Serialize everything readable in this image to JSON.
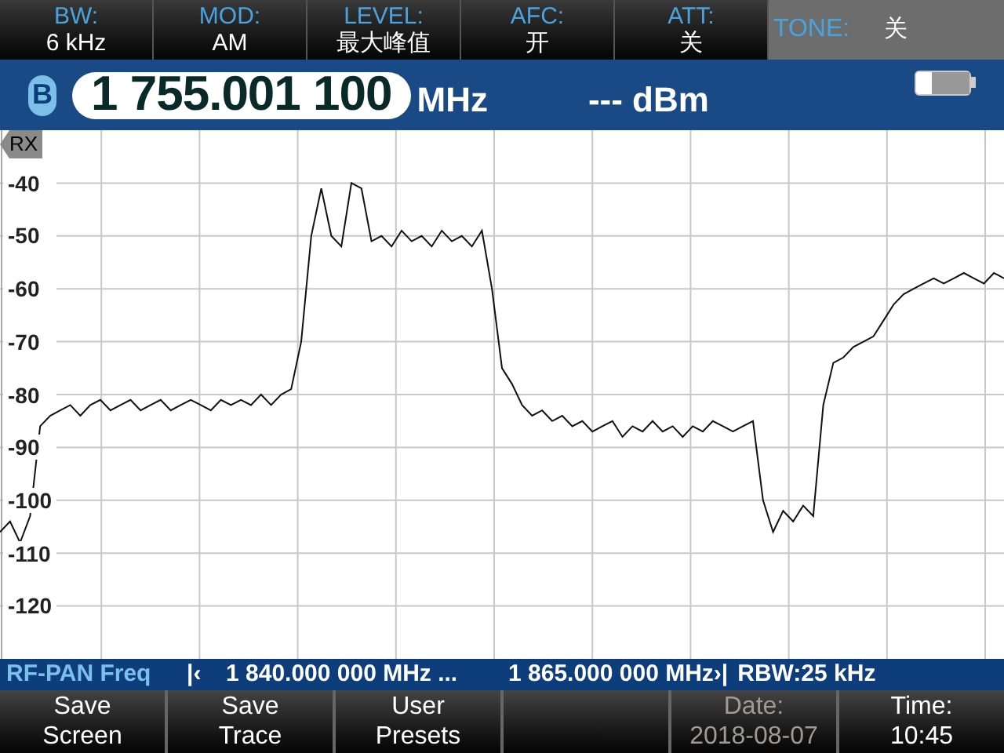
{
  "settings": [
    {
      "label": "BW:",
      "value": "6 kHz"
    },
    {
      "label": "MOD:",
      "value": "AM"
    },
    {
      "label": "LEVEL:",
      "value": "最大峰值"
    },
    {
      "label": "AFC:",
      "value": "开"
    },
    {
      "label": "ATT:",
      "value": "关"
    }
  ],
  "tone": {
    "label": "TONE:",
    "value": "关"
  },
  "receiver": {
    "badge": "B",
    "frequency": "1 755.001 100",
    "unit": "MHz",
    "level": "--- dBm"
  },
  "spectrum": {
    "chart_data": {
      "type": "line",
      "ylim": [
        -130,
        -30
      ],
      "grid": true,
      "yticks": [
        -40,
        -50,
        -60,
        -70,
        -80,
        -90,
        -100,
        -110,
        -120
      ],
      "categories": [
        null,
        null,
        null,
        null,
        null,
        null,
        null,
        null,
        null,
        null,
        null,
        null,
        null,
        null,
        null,
        null,
        null,
        null,
        null,
        null,
        null,
        null,
        null,
        null,
        null,
        null,
        null,
        null,
        null,
        null,
        null,
        null,
        null,
        null,
        null,
        null,
        null,
        null,
        null,
        null,
        null,
        null,
        null,
        null,
        null,
        null,
        null,
        null,
        null,
        null,
        null,
        null,
        null,
        null,
        null,
        null,
        null,
        null,
        null,
        null,
        null,
        null,
        null,
        null,
        null,
        null,
        null,
        null,
        null,
        null,
        null,
        null,
        null,
        null,
        null,
        null,
        null,
        null,
        null,
        null,
        null,
        null,
        null,
        null,
        null,
        null,
        null,
        null,
        null,
        null,
        null,
        null,
        null,
        null,
        null,
        null,
        null,
        null,
        null,
        null,
        null
      ],
      "series": [
        {
          "name": "RX",
          "color": "#111111",
          "values": [
            -106,
            -104,
            -108,
            -103,
            -86,
            -84,
            -83,
            -82,
            -84,
            -82,
            -81,
            -83,
            -82,
            -81,
            -83,
            -82,
            -81,
            -83,
            -82,
            -81,
            -82,
            -83,
            -81,
            -82,
            -81,
            -82,
            -80,
            -82,
            -80,
            -79,
            -70,
            -50,
            -41,
            -50,
            -52,
            -40,
            -41,
            -51,
            -50,
            -52,
            -49,
            -51,
            -50,
            -52,
            -49,
            -51,
            -50,
            -52,
            -49,
            -60,
            -75,
            -78,
            -82,
            -84,
            -83,
            -85,
            -84,
            -86,
            -85,
            -87,
            -86,
            -85,
            -88,
            -86,
            -87,
            -85,
            -87,
            -86,
            -88,
            -86,
            -87,
            -85,
            -86,
            -87,
            -86,
            -85,
            -100,
            -106,
            -102,
            -104,
            -101,
            -103,
            -82,
            -74,
            -73,
            -71,
            -70,
            -69,
            -66,
            -63,
            -61,
            -60,
            -59,
            -58,
            -59,
            -58,
            -57,
            -58,
            -59,
            -57,
            -58
          ]
        }
      ]
    }
  },
  "status_bar": {
    "mode": "RF-PAN Freq",
    "start_icon": "|‹",
    "start": "1 840.000 000 MHz ...",
    "stop": "1 865.000 000 MHz",
    "stop_icon": "›|",
    "rbw": "RBW:25 kHz"
  },
  "softkeys": [
    {
      "kind": "key",
      "label": "Save",
      "value": "Screen",
      "disabled": false
    },
    {
      "kind": "key",
      "label": "Save",
      "value": "Trace",
      "disabled": false
    },
    {
      "kind": "key",
      "label": "User",
      "value": "Presets",
      "disabled": false
    },
    {
      "kind": "blank"
    },
    {
      "kind": "key",
      "label": "Date:",
      "value": "2018-08-07",
      "disabled": true
    },
    {
      "kind": "key",
      "label": "Time:",
      "value": "10:45",
      "disabled": false
    }
  ]
}
